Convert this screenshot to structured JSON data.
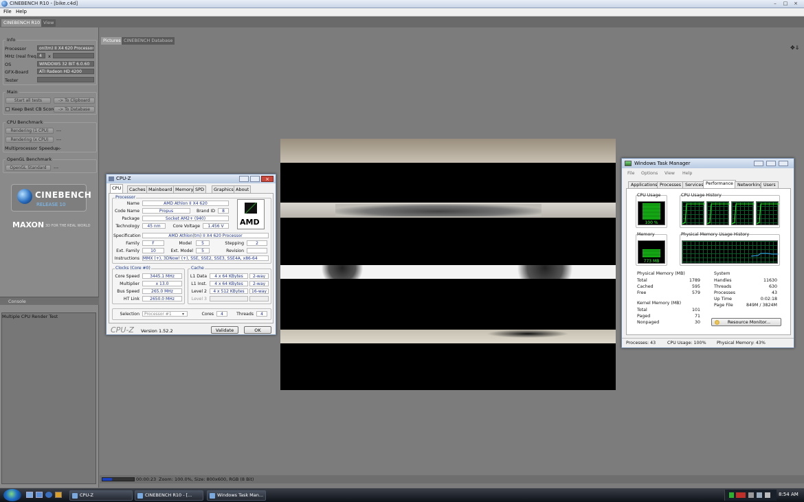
{
  "window": {
    "title": "CINEBENCH R10 - [bike.c4d]",
    "min": "–",
    "max": "□",
    "close": "×"
  },
  "menu": {
    "file": "File",
    "help": "Help"
  },
  "tabs": {
    "app": "CINEBENCH R10",
    "view": "View"
  },
  "info": {
    "title": "Info",
    "processor_label": "Processor",
    "processor_value": "on(tm) II X4 620 Processor",
    "mhz_label": "MHz (real freq.)",
    "mhz_value": "4",
    "mhz_x": "x",
    "os_label": "OS",
    "os_value": "WINDOWS 32 BIT 6.0.60",
    "gfx_label": "GFX-Board",
    "gfx_value": "ATI Radeon HD 4200",
    "tester_label": "Tester",
    "tester_value": ""
  },
  "main": {
    "title": "Main",
    "start": "Start all tests",
    "clipboard": "-> To Clipboard",
    "keep_best": "Keep Best CB Score",
    "database": "-> To Database"
  },
  "cpu_bench": {
    "title": "CPU Benchmark",
    "single": "Rendering (1 CPU)",
    "single_val": "---",
    "multi": "Rendering (x CPU)",
    "multi_val": "---",
    "speedup_label": "Multiprocessor Speedup:",
    "speedup_val": "---"
  },
  "gl_bench": {
    "title": "OpenGL Benchmark",
    "button": "OpenGL Standard",
    "value": "---"
  },
  "logo": {
    "name": "CINEBENCH",
    "release": "RELEASE 10",
    "maxon": "MAXON",
    "tagline": "3D FOR THE REAL WORLD"
  },
  "console": {
    "title": "Console",
    "text": "Multiple CPU Render Test"
  },
  "right_tabs": {
    "pictures": "Pictures",
    "database": "CINEBENCH Database"
  },
  "status": {
    "time": "00:00:23",
    "info": "Zoom: 100.0%, Size: 800x600, RGB (8 Bit)",
    "progress": 0.3
  },
  "cpuz": {
    "title": "CPU-Z",
    "tabs": [
      "CPU",
      "Caches",
      "Mainboard",
      "Memory",
      "SPD",
      "Graphics",
      "About"
    ],
    "processor_group": "Processor",
    "name_l": "Name",
    "name": "AMD Athlon II X4 620",
    "codename_l": "Code Name",
    "codename": "Propus",
    "brand_l": "Brand ID",
    "brand": "8",
    "package_l": "Package",
    "package": "Socket AM2+ (940)",
    "tech_l": "Technology",
    "tech": "45 nm",
    "voltage_l": "Core Voltage",
    "voltage": "1.456 V",
    "spec_l": "Specification",
    "spec": "AMD Athlon(tm) II X4 620 Processor",
    "family_l": "Family",
    "family": "F",
    "model_l": "Model",
    "model": "5",
    "stepping_l": "Stepping",
    "stepping": "2",
    "extfam_l": "Ext. Family",
    "extfam": "10",
    "extmodel_l": "Ext. Model",
    "extmodel": "5",
    "revision_l": "Revision",
    "revision": "",
    "instr_l": "Instructions",
    "instr": "MMX (+), 3DNow! (+), SSE, SSE2, SSE3, SSE4A, x86-64",
    "clocks_group": "Clocks (Core #0)",
    "corespeed_l": "Core Speed",
    "corespeed": "3445.1 MHz",
    "mult_l": "Multiplier",
    "mult": "x 13.0",
    "bus_l": "Bus Speed",
    "bus": "265.0 MHz",
    "ht_l": "HT Link",
    "ht": "2650.0 MHz",
    "cache_group": "Cache",
    "l1d_l": "L1 Data",
    "l1d": "4 x 64 KBytes",
    "l1d_w": "2-way",
    "l1i_l": "L1 Inst.",
    "l1i": "4 x 64 KBytes",
    "l1i_w": "2-way",
    "l2_l": "Level 2",
    "l2": "4 x 512 KBytes",
    "l2_w": "16-way",
    "l3_l": "Level 3",
    "selection_l": "Selection",
    "selection": "Processor #1",
    "cores_l": "Cores",
    "cores": "4",
    "threads_l": "Threads",
    "threads": "4",
    "brand_logo": "CPU-Z",
    "version": "Version 1.52.2",
    "validate": "Validate",
    "ok": "OK",
    "amd": "AMD"
  },
  "tm": {
    "title": "Windows Task Manager",
    "menu": [
      "File",
      "Options",
      "View",
      "Help"
    ],
    "tabs": [
      "Applications",
      "Processes",
      "Services",
      "Performance",
      "Networking",
      "Users"
    ],
    "cpu_usage": "CPU Usage",
    "cpu_value": "100 %",
    "cpu_history": "CPU Usage History",
    "memory": "Memory",
    "mem_value": "773 MB",
    "mem_history": "Physical Memory Usage History",
    "phys_title": "Physical Memory (MB)",
    "total_l": "Total",
    "total": "1789",
    "cached_l": "Cached",
    "cached": "595",
    "free_l": "Free",
    "free": "579",
    "kern_title": "Kernel Memory (MB)",
    "ktotal_l": "Total",
    "ktotal": "101",
    "paged_l": "Paged",
    "paged": "71",
    "nonpaged_l": "Nonpaged",
    "nonpaged": "30",
    "sys_title": "System",
    "handles_l": "Handles",
    "handles": "11630",
    "threads_l": "Threads",
    "threads": "630",
    "processes_l": "Processes",
    "processes": "43",
    "uptime_l": "Up Time",
    "uptime": "0:02:18",
    "pagefile_l": "Page File",
    "pagefile": "849M / 3824M",
    "resmon": "Resource Monitor...",
    "status_proc": "Processes: 43",
    "status_cpu": "CPU Usage: 100%",
    "status_mem": "Physical Memory: 43%"
  },
  "taskbar": {
    "items": [
      "CPU-Z",
      "CINEBENCH R10 - [...",
      "Windows Task Man..."
    ],
    "clock": "8:54 AM"
  }
}
